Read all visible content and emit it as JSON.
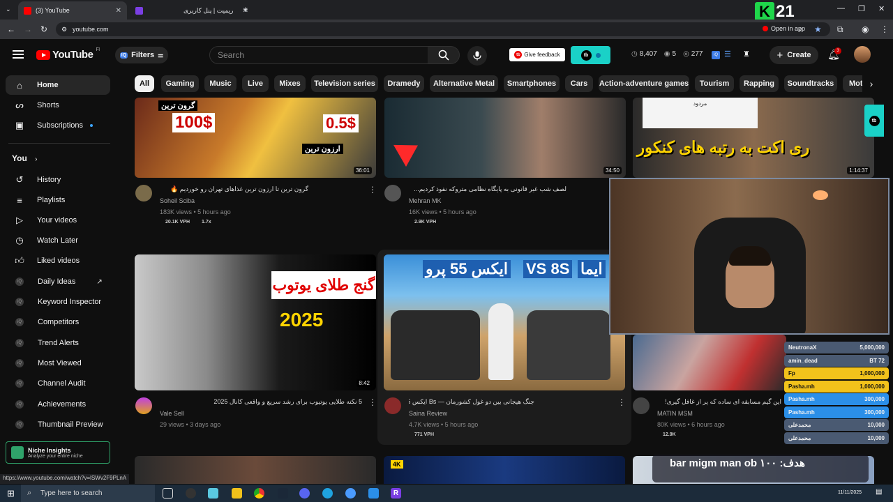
{
  "browser": {
    "tabs": [
      {
        "title": "(3) YouTube",
        "fav_color": "#ff0000"
      },
      {
        "title": "ریمیت | پنل کاربری",
        "fav_color": "#7b3fe4"
      }
    ],
    "url": "youtube.com",
    "open_in_app": "Open in app",
    "status_url": "https://www.youtube.com/watch?v=lSWv2F9PLnA"
  },
  "stream_logo": {
    "text": "21"
  },
  "youtube": {
    "logo_text": "YouTube",
    "logo_region": "FI",
    "filters_label": "Filters",
    "filters_badge": "IQ",
    "search_placeholder": "Search",
    "feedback_label": "Give feedback",
    "stats": {
      "views": "8,407",
      "eye": "5",
      "other": "277"
    },
    "create_label": "Create",
    "notifications": "3"
  },
  "sidebar": {
    "main": [
      {
        "label": "Home",
        "icon": "home-icon"
      },
      {
        "label": "Shorts",
        "icon": "shorts-icon"
      },
      {
        "label": "Subscriptions",
        "icon": "subscriptions-icon"
      }
    ],
    "you_label": "You",
    "you_items": [
      {
        "label": "History",
        "icon": "history-icon"
      },
      {
        "label": "Playlists",
        "icon": "playlists-icon"
      },
      {
        "label": "Your videos",
        "icon": "your-videos-icon"
      },
      {
        "label": "Watch Later",
        "icon": "clock-icon"
      },
      {
        "label": "Liked videos",
        "icon": "thumbs-up-icon"
      }
    ],
    "tools": [
      {
        "label": "Daily Ideas"
      },
      {
        "label": "Keyword Inspector"
      },
      {
        "label": "Competitors"
      },
      {
        "label": "Trend Alerts"
      },
      {
        "label": "Most Viewed"
      },
      {
        "label": "Channel Audit"
      },
      {
        "label": "Achievements"
      },
      {
        "label": "Thumbnail Preview"
      }
    ],
    "niche": {
      "title": "Niche Insights",
      "subtitle": "Analyze your entire niche"
    }
  },
  "chips": [
    "All",
    "Gaming",
    "Music",
    "Live",
    "Mixes",
    "Television series",
    "Dramedy",
    "Alternative Metal",
    "Smartphones",
    "Cars",
    "Action-adventure games",
    "Tourism",
    "Rapping",
    "Soundtracks",
    "Moto"
  ],
  "videos": [
    {
      "title": "گرون ترین تا ارزون ترین غذاهای تهران رو خوردیم 🔥",
      "channel": "Soheil Sciba",
      "meta": "183K views • 5 hours ago",
      "stat1": "20.1K VPH",
      "stat2": "1.7x",
      "duration": "36:01",
      "thumb_texts": [
        "گرون ترین",
        "100$",
        "0.5$",
        "ارزون ترین"
      ]
    },
    {
      "title": "لصف شب غیر قانونی به پایگاه نظامی متروکه نفوذ کردیم...",
      "channel": "Mehran MK",
      "meta": "16K views • 5 hours ago",
      "stat1": "2.9K VPH",
      "stat2": "",
      "duration": "34:50",
      "thumb_texts": []
    },
    {
      "title": "",
      "channel": "",
      "meta": "",
      "stat1": "",
      "stat2": "",
      "duration": "1:14:37",
      "thumb_texts": [
        "مردود",
        "ری اکت به رتبه های کنکور"
      ]
    },
    {
      "title": "5 نکته طلایی یوتیوب برای رشد سریع و واقعی کانال 2025",
      "channel": "Vale Sell",
      "meta": "29 views • 3 days ago",
      "stat1": "",
      "stat2": "",
      "duration": "8:42",
      "thumb_texts": [
        "گنج طلای یوتوب",
        "2025"
      ]
    },
    {
      "title": "جنگ هیجانی بین دو غول کشورمان — Bs ایکس 55 پرو",
      "channel": "Saina Review",
      "meta": "4.7K views • 5 hours ago",
      "stat1": "771 VPH",
      "stat2": "",
      "duration": "",
      "thumb_texts": [
        "ایکس 55 پرو",
        "VS 8S",
        "ایما"
      ]
    },
    {
      "title": "این گیم مسابقه ای ساده که پر از غافل گیری!",
      "channel": "MATIN MSM",
      "meta": "80K views • 6 hours ago",
      "stat1": "12.9K",
      "stat2": "",
      "duration": "",
      "thumb_texts": []
    }
  ],
  "donations": [
    {
      "name": "NeutronaX",
      "amount": "5,000,000",
      "color": "#4a5a72"
    },
    {
      "name": "amin_dead",
      "amount": "BT 72",
      "color": "#4a5a72"
    },
    {
      "name": "Fp",
      "amount": "1,000,000",
      "color": "#f2c21b"
    },
    {
      "name": "Pasha.mh",
      "amount": "1,000,000",
      "color": "#f2c21b"
    },
    {
      "name": "Pasha.mh",
      "amount": "300,000",
      "color": "#2b8fe8"
    },
    {
      "name": "Pasha.mh",
      "amount": "300,000",
      "color": "#2b8fe8"
    },
    {
      "name": "محمدعلی",
      "amount": "10,000",
      "color": "#4a5a72"
    },
    {
      "name": "محمدعلی",
      "amount": "10,000",
      "color": "#4a5a72"
    }
  ],
  "goal_text": "هدف: bar migm man ob ۱۰۰",
  "taskbar": {
    "search_placeholder": "Type here to search",
    "date": "11/11/2025"
  }
}
